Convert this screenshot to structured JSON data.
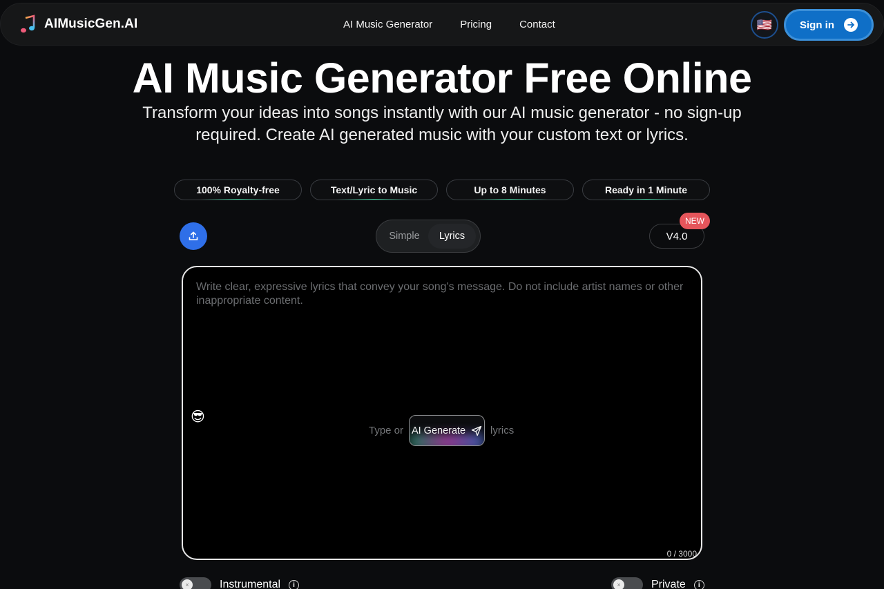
{
  "header": {
    "brand": "AIMusicGen.AI",
    "nav": [
      "AI Music Generator",
      "Pricing",
      "Contact"
    ],
    "language_flag": "🇺🇸",
    "signin_label": "Sign in"
  },
  "hero": {
    "title": "AI Music Generator Free Online",
    "subtitle": "Transform your ideas into songs instantly with our AI music generator - no sign-up required. Create AI generated music with your custom text or lyrics."
  },
  "features": [
    "100% Royalty-free",
    "Text/Lyric to Music",
    "Up to 8 Minutes",
    "Ready in 1 Minute"
  ],
  "controls": {
    "modes": [
      "Simple",
      "Lyrics"
    ],
    "active_mode": "Lyrics",
    "version": "V4.0",
    "new_badge": "NEW"
  },
  "editor": {
    "placeholder": "Write clear, expressive lyrics that convey your song's message. Do not include artist names or other inappropriate content.",
    "emoji": "😎",
    "prefix": "Type or",
    "ai_button": "AI Generate",
    "suffix": "lyrics",
    "counter": "0 / 3000"
  },
  "options": {
    "instrumental_label": "Instrumental",
    "private_label": "Private"
  },
  "colors": {
    "background": "#0b0c0e",
    "signin": "#0f6fc7",
    "upload": "#2f6fe8",
    "badge": "#e5555b"
  }
}
